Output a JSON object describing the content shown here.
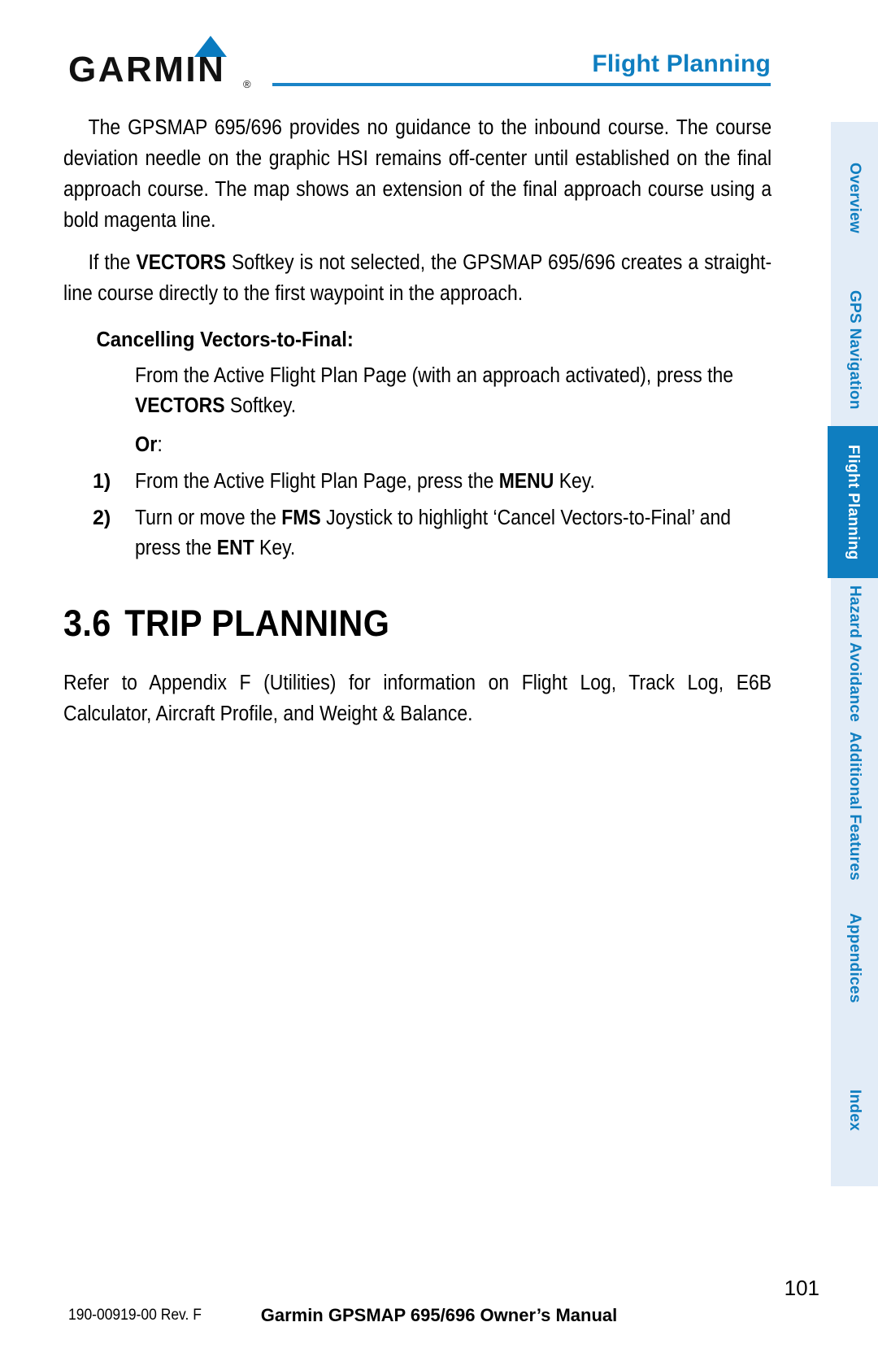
{
  "document": {
    "header": {
      "logo_text": "GARMIN",
      "logo_registered": "®",
      "chapter_title": "Flight Planning"
    },
    "body": {
      "paragraph_1": "The GPSMAP 695/696 provides no guidance to the inbound course.  The course deviation needle on the graphic HSI remains off-center until established on the final approach course.  The map shows an extension of the final approach course using a bold magenta line.",
      "paragraph_2_pre": "If the ",
      "paragraph_2_bold": "VECTORS",
      "paragraph_2_post": " Softkey is not selected, the GPSMAP 695/696 creates a straight-line course directly to the first waypoint in the approach.",
      "procedure_heading": "Cancelling Vectors-to-Final:",
      "procedure_text_pre": "From the Active Flight Plan Page (with an approach activated), press the ",
      "procedure_text_bold": "VECTORS",
      "procedure_text_post": " Softkey.",
      "or_label": "Or",
      "or_colon": ":",
      "steps": [
        {
          "number": "1)",
          "pre": "From the Active Flight Plan Page, press the ",
          "bold": "MENU",
          "post": " Key."
        },
        {
          "number": "2)",
          "pre": "Turn or move the ",
          "bold": "FMS",
          "mid": " Joystick to highlight ‘Cancel Vectors-to-Final’ and press the ",
          "bold2": "ENT",
          "post": " Key."
        }
      ],
      "section_number": "3.6",
      "section_title": "TRIP PLANNING",
      "section_paragraph": "Refer to Appendix F (Utilities) for information on Flight Log, Track Log, E6B Calculator, Aircraft Profile, and Weight & Balance."
    },
    "sidebar": {
      "tabs": [
        {
          "label": "Overview",
          "active": false
        },
        {
          "label": "GPS Navigation",
          "active": false
        },
        {
          "label": "Flight Planning",
          "active": true
        },
        {
          "label": "Hazard Avoidance",
          "active": false
        },
        {
          "label": "Additional Features",
          "active": false
        },
        {
          "label": "Appendices",
          "active": false
        },
        {
          "label": "Index",
          "active": false
        }
      ]
    },
    "footer": {
      "part_number": "190-00919-00 Rev. F",
      "manual_title": "Garmin GPSMAP 695/696 Owner’s Manual",
      "page_number": "101"
    },
    "colors": {
      "brand_blue": "#0f7ec0",
      "rule_blue": "#1b84c7",
      "tab_inactive_bg": "#e2ecf7",
      "tab_active_bg": "#0f7ec0",
      "text_black": "#000000"
    }
  }
}
